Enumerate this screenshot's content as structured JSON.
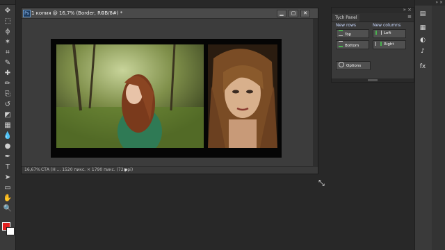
{
  "document": {
    "title": "1 копия @ 16,7% (Border, RGB/8#) *",
    "close_glyph": "×",
    "ps_badge": "Ps",
    "window_buttons": [
      "▁",
      "▢",
      "✕"
    ],
    "status_zoom": "16,67%",
    "status_info": "СТА (Н ... 1520 пикс. × 1790 пикс. (72 ppi)",
    "status_arrow": "▶"
  },
  "tych_panel": {
    "tab_label": "Tych Panel",
    "new_rows_label": "New rows",
    "new_columns_label": "New columns",
    "buttons": {
      "top": "Top",
      "bottom": "Bottom",
      "left": "Left",
      "right": "Right",
      "options": "Options"
    },
    "colors": {
      "accent": "#49b34e",
      "group_label": "#c8d8ff"
    }
  },
  "tools": [
    "move-icon",
    "marquee-icon",
    "lasso-icon",
    "magic-wand-icon",
    "crop-icon",
    "eyedropper-icon",
    "healing-brush-icon",
    "brush-icon",
    "clone-stamp-icon",
    "history-brush-icon",
    "eraser-icon",
    "gradient-icon",
    "blur-icon",
    "dodge-icon",
    "pen-icon",
    "type-icon",
    "path-select-icon",
    "shape-icon",
    "hand-icon",
    "zoom-icon"
  ],
  "tool_glyphs": [
    "✥",
    "⬚",
    "ϕ",
    "✶",
    "⌗",
    "✎",
    "✚",
    "✏",
    "⎘",
    "↺",
    "◩",
    "▦",
    "💧",
    "●",
    "✒",
    "T",
    "➤",
    "▭",
    "✋",
    "🔍"
  ],
  "colors": {
    "foreground": "#e02020",
    "background": "#ffffff"
  },
  "right_dock": {
    "glyphs": [
      "▤",
      "▦",
      "◐",
      "♪",
      "fx"
    ],
    "names": [
      "history-icon",
      "color-icon",
      "adjustments-icon",
      "audio-icon",
      "styles-icon"
    ]
  }
}
